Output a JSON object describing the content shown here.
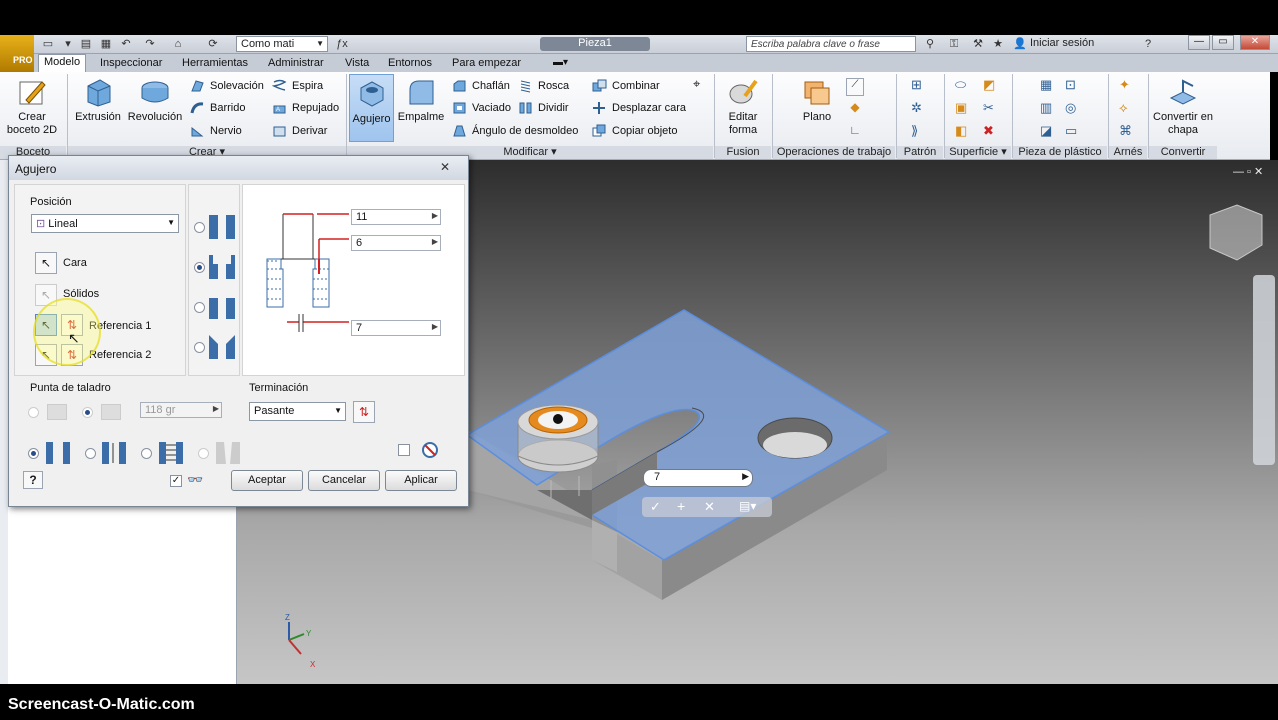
{
  "quick_access": {
    "logo_text": "PRO",
    "appearance_combo": "Como mati",
    "document_title": "Pieza1",
    "search_placeholder": "Escriba palabra clave o frase",
    "sign_in": "Iniciar sesión",
    "help": "?"
  },
  "tabs": [
    "Modelo",
    "Inspeccionar",
    "Herramientas",
    "Administrar",
    "Vista",
    "Entornos",
    "Para empezar"
  ],
  "ribbon": {
    "sketch": {
      "create_sketch": "Crear boceto 2D",
      "group": "Boceto"
    },
    "create": {
      "extrude": "Extrusión",
      "revolve": "Revolución",
      "loft": "Solevación",
      "sweep": "Barrido",
      "rib": "Nervio",
      "coil": "Espira",
      "emboss": "Repujado",
      "derive": "Derivar",
      "group": "Crear"
    },
    "modify": {
      "hole": "Agujero",
      "fillet": "Empalme",
      "chamfer": "Chaflán",
      "shell": "Vaciado",
      "draft": "Ángulo de desmoldeo",
      "thread": "Rosca",
      "split": "Dividir",
      "combine": "Combinar",
      "move_face": "Desplazar cara",
      "copy_object": "Copiar objeto",
      "group": "Modificar"
    },
    "fusion": {
      "edit_form": "Editar forma",
      "group": "Fusion"
    },
    "work_features": {
      "plane": "Plano",
      "group": "Operaciones de trabajo"
    },
    "pattern": {
      "group": "Patrón"
    },
    "surface": {
      "group": "Superficie"
    },
    "plastic": {
      "group": "Pieza de plástico"
    },
    "harness": {
      "group": "Arnés"
    },
    "convert": {
      "to_sheet_metal": "Convertir en chapa",
      "group": "Convertir"
    }
  },
  "dialog": {
    "title": "Agujero",
    "position_label": "Posición",
    "position_value": "Lineal",
    "face": "Cara",
    "solids": "Sólidos",
    "reference1": "Referencia 1",
    "reference2": "Referencia 2",
    "dim_top": "11",
    "dim_mid": "6",
    "dim_bottom": "7",
    "drill_point_label": "Punta de taladro",
    "drill_point_angle": "118 gr",
    "termination_label": "Terminación",
    "termination_value": "Pasante",
    "help": "?",
    "ok": "Aceptar",
    "cancel": "Cancelar",
    "apply": "Aplicar"
  },
  "canvas": {
    "distance_input": "7",
    "axis_labels": {
      "z": "Z",
      "y": "Y",
      "x": "X"
    }
  },
  "watermark": "Screencast-O-Matic.com",
  "colors": {
    "selection_blue": "#5b8ede",
    "highlight_yellow": "#f5ee4a",
    "dim_red": "#d42020",
    "hatch_blue": "#3b6ea8"
  }
}
